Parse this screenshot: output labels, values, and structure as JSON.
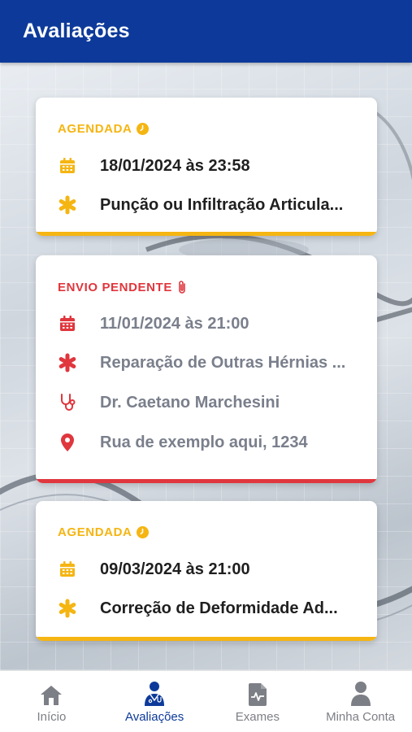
{
  "header": {
    "title": "Avaliações"
  },
  "colors": {
    "primary": "#0d3a9a",
    "scheduled": "#f5b512",
    "pending": "#e0363d",
    "text_dark": "#1f1f1f",
    "text_muted": "#7a7f8c",
    "nav_inactive": "#7d7f86"
  },
  "cards": [
    {
      "status": "AGENDADA",
      "status_icon": "clock-icon",
      "date": "18/01/2024 às 23:58",
      "procedure": "Punção ou Infiltração Articula...",
      "doctor": null,
      "address": null
    },
    {
      "status": "ENVIO PENDENTE",
      "status_icon": "paperclip-icon",
      "date": "11/01/2024 às 21:00",
      "procedure": "Reparação de Outras Hérnias ...",
      "doctor": "Dr. Caetano Marchesini",
      "address": "Rua de exemplo aqui, 1234"
    },
    {
      "status": "AGENDADA",
      "status_icon": "clock-icon",
      "date": "09/03/2024 às 21:00",
      "procedure": "Correção de Deformidade Ad...",
      "doctor": null,
      "address": null
    }
  ],
  "nav": {
    "active": "Avaliações",
    "items": [
      {
        "label": "Início",
        "icon": "home-icon"
      },
      {
        "label": "Avaliações",
        "icon": "doctor-icon"
      },
      {
        "label": "Exames",
        "icon": "exam-report-icon"
      },
      {
        "label": "Minha Conta",
        "icon": "user-icon"
      }
    ]
  }
}
